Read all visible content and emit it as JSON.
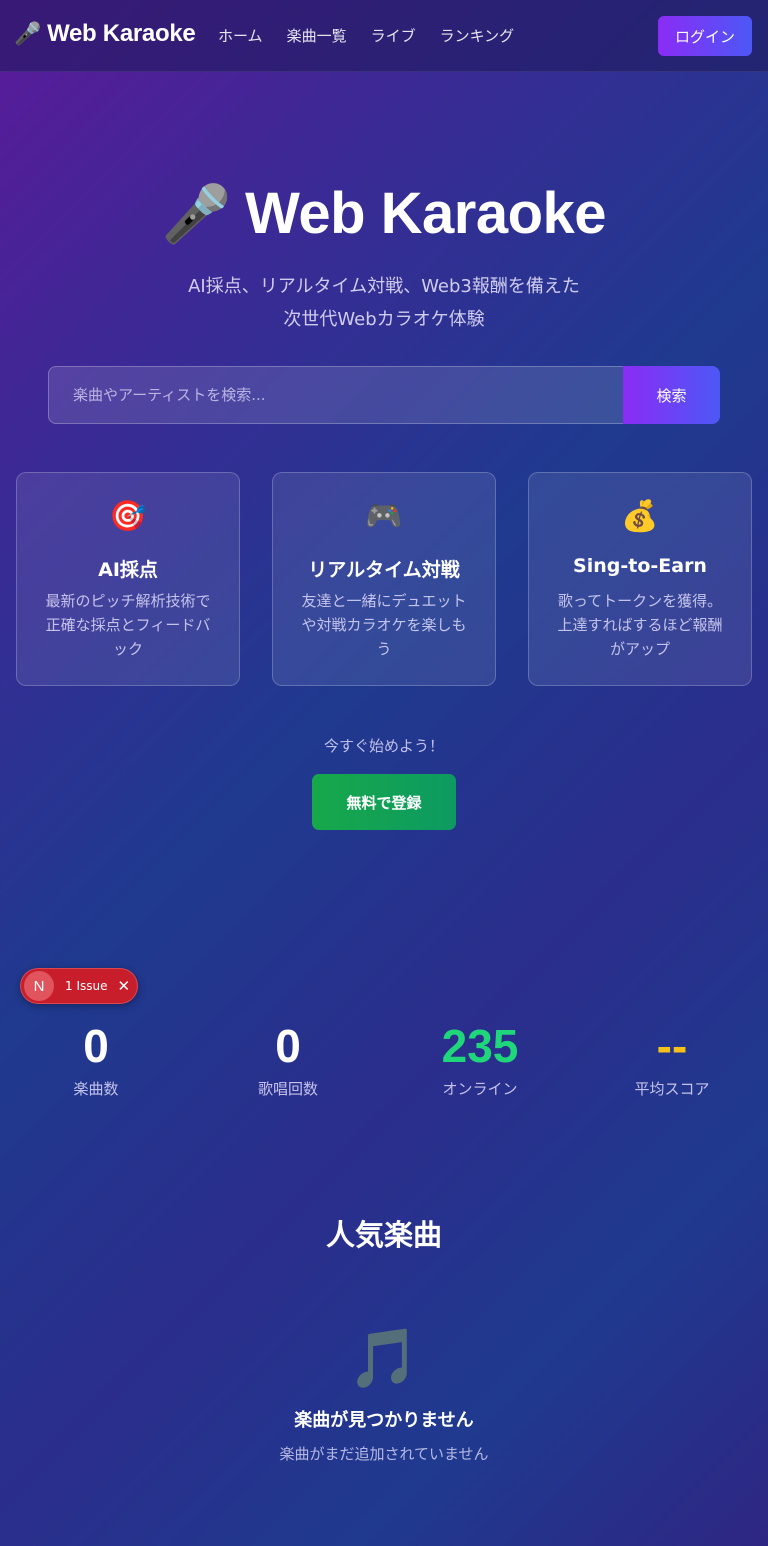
{
  "nav": {
    "brand_icon": "microphone-icon",
    "brand_emoji": "🎤",
    "brand": "Web Karaoke",
    "links": [
      "ホーム",
      "楽曲一覧",
      "ライブ",
      "ランキング"
    ],
    "login": "ログイン"
  },
  "hero": {
    "title_emoji": "🎤",
    "title": "Web Karaoke",
    "subtitle_line1": "AI採点、リアルタイム対戦、Web3報酬を備えた",
    "subtitle_line2": "次世代Webカラオケ体験"
  },
  "search": {
    "placeholder": "楽曲やアーティストを検索...",
    "button": "検索"
  },
  "features": [
    {
      "icon": "target-icon",
      "emoji": "🎯",
      "title": "AI採点",
      "desc": "最新のピッチ解析技術で正確な採点とフィードバック"
    },
    {
      "icon": "gamepad-icon",
      "emoji": "🎮",
      "title": "リアルタイム対戦",
      "desc": "友達と一緒にデュエットや対戦カラオケを楽しもう"
    },
    {
      "icon": "money-bag-icon",
      "emoji": "💰",
      "title": "Sing-to-Earn",
      "desc": "歌ってトークンを獲得。上達すればするほど報酬がアップ"
    }
  ],
  "cta": {
    "text": "今すぐ始めよう！",
    "button": "無料で登録"
  },
  "issue_badge": {
    "logo": "N",
    "text": "1 Issue",
    "close": "✕"
  },
  "stats": [
    {
      "value": "0",
      "label": "楽曲数",
      "color": "#ffffff"
    },
    {
      "value": "0",
      "label": "歌唱回数",
      "color": "#ffffff"
    },
    {
      "value": "235",
      "label": "オンライン",
      "color": "#1fd67a"
    },
    {
      "value": "--",
      "label": "平均スコア",
      "color": "#f6c21a"
    }
  ],
  "popular": {
    "title": "人気楽曲",
    "empty_icon": "music-note-icon",
    "empty_emoji": "🎵",
    "empty_title": "楽曲が見つかりません",
    "empty_sub": "楽曲がまだ追加されていません"
  }
}
